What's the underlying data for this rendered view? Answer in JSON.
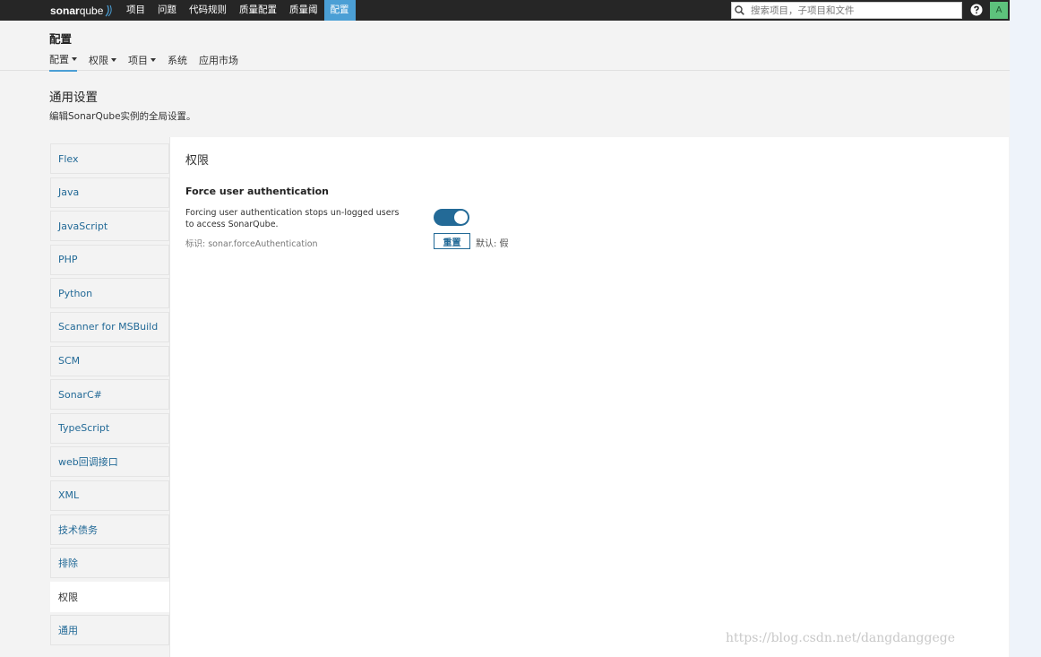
{
  "navbar": {
    "logo_bold": "sonar",
    "logo_light": "qube",
    "items": [
      {
        "label": "项目",
        "active": false
      },
      {
        "label": "问题",
        "active": false
      },
      {
        "label": "代码规则",
        "active": false
      },
      {
        "label": "质量配置",
        "active": false
      },
      {
        "label": "质量阈",
        "active": false
      },
      {
        "label": "配置",
        "active": true
      }
    ],
    "search_placeholder": "搜索项目，子项目和文件",
    "avatar_letter": "A",
    "help_icon": "question-circle-icon",
    "search_icon": "search-icon"
  },
  "context": {
    "title": "配置",
    "tabs": [
      {
        "label": "配置",
        "dropdown": true,
        "active": true
      },
      {
        "label": "权限",
        "dropdown": true,
        "active": false
      },
      {
        "label": "项目",
        "dropdown": true,
        "active": false
      },
      {
        "label": "系统",
        "dropdown": false,
        "active": false
      },
      {
        "label": "应用市场",
        "dropdown": false,
        "active": false
      }
    ]
  },
  "page": {
    "title": "通用设置",
    "description": "编辑SonarQube实例的全局设置。"
  },
  "categories": [
    {
      "label": "Flex",
      "active": false
    },
    {
      "label": "Java",
      "active": false
    },
    {
      "label": "JavaScript",
      "active": false
    },
    {
      "label": "PHP",
      "active": false
    },
    {
      "label": "Python",
      "active": false
    },
    {
      "label": "Scanner for MSBuild",
      "active": false
    },
    {
      "label": "SCM",
      "active": false
    },
    {
      "label": "SonarC#",
      "active": false
    },
    {
      "label": "TypeScript",
      "active": false
    },
    {
      "label": "web回调接口",
      "active": false
    },
    {
      "label": "XML",
      "active": false
    },
    {
      "label": "技术债务",
      "active": false
    },
    {
      "label": "排除",
      "active": false
    },
    {
      "label": "权限",
      "active": true
    },
    {
      "label": "通用",
      "active": false
    }
  ],
  "section": {
    "title": "权限",
    "setting": {
      "name": "Force user authentication",
      "description": "Forcing user authentication stops un-logged users to access SonarQube.",
      "key": "标识: sonar.forceAuthentication",
      "toggle_on": true,
      "reset_label": "重置",
      "default_label": "默认: 假"
    }
  },
  "watermark": "https://blog.csdn.net/dangdanggege",
  "colors": {
    "navbar_bg": "#262626",
    "accent": "#4b9fd5",
    "link": "#236a97",
    "avatar_bg": "#5dc27c"
  }
}
